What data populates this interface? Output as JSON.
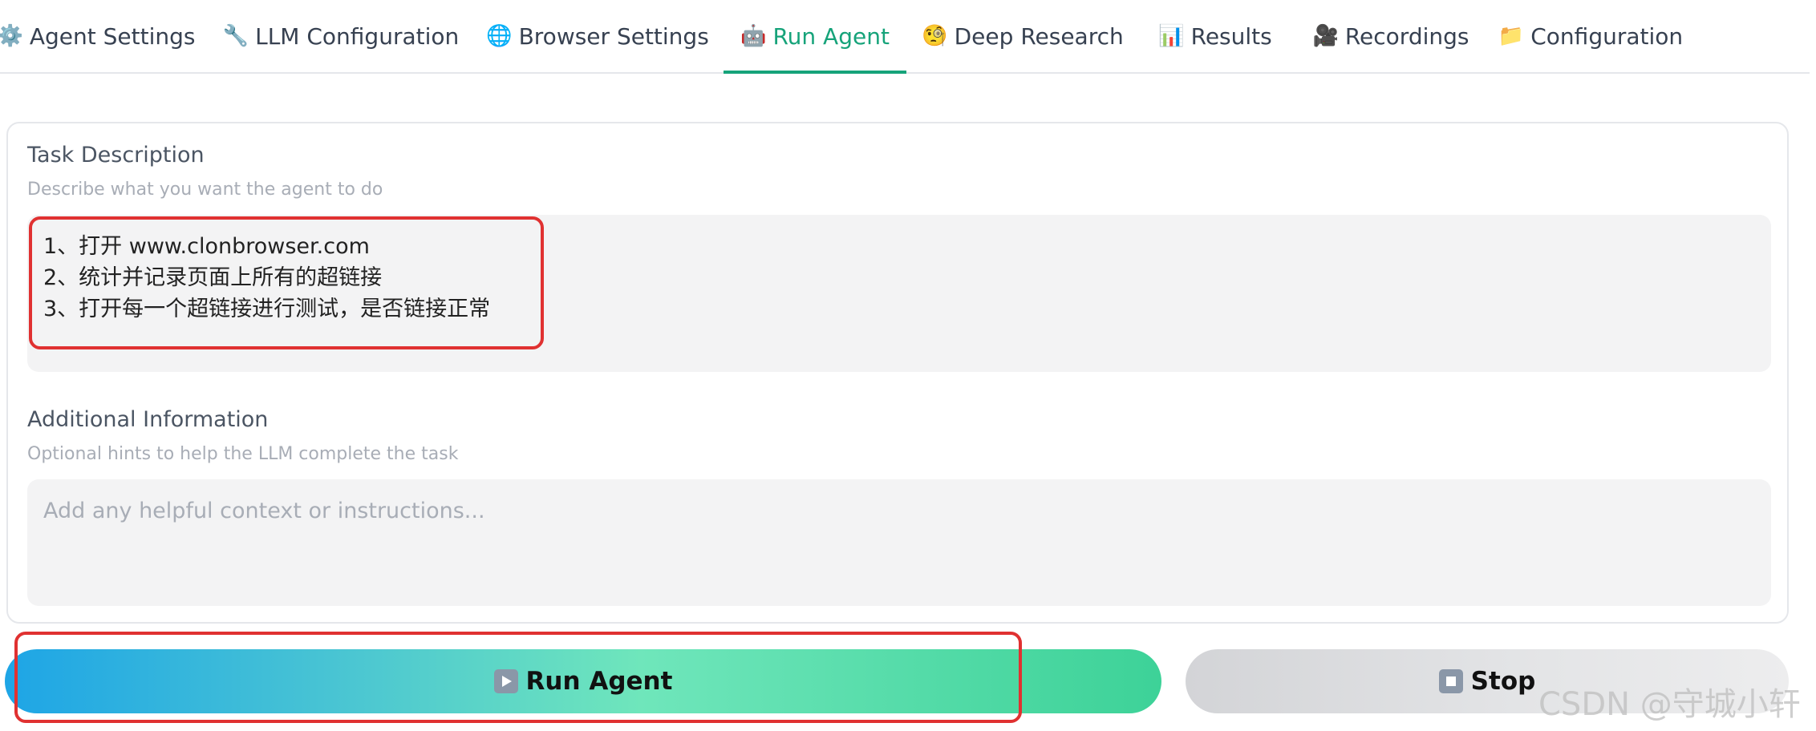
{
  "tabs": [
    {
      "icon": "⚙️",
      "icon_name": "gear-icon",
      "label": "Agent Settings"
    },
    {
      "icon": "🔧",
      "icon_name": "wrench-icon",
      "label": "LLM Configuration"
    },
    {
      "icon": "🌐",
      "icon_name": "globe-icon",
      "label": "Browser Settings"
    },
    {
      "icon": "🤖",
      "icon_name": "robot-icon",
      "label": "Run Agent",
      "active": true
    },
    {
      "icon": "🧐",
      "icon_name": "monocle-face-icon",
      "label": "Deep Research"
    },
    {
      "icon": "📊",
      "icon_name": "bar-chart-icon",
      "label": "Results"
    },
    {
      "icon": "🎥",
      "icon_name": "movie-camera-icon",
      "label": "Recordings"
    },
    {
      "icon": "📁",
      "icon_name": "folder-icon",
      "label": "Configuration"
    }
  ],
  "task": {
    "label": "Task Description",
    "hint": "Describe what you want the agent to do",
    "value": "1、打开 www.clonbrowser.com\n2、统计并记录页面上所有的超链接\n3、打开每一个超链接进行测试，是否链接正常"
  },
  "additional": {
    "label": "Additional Information",
    "hint": "Optional hints to help the LLM complete the task",
    "placeholder": "Add any helpful context or instructions..."
  },
  "buttons": {
    "run_label": "Run Agent",
    "stop_label": "Stop"
  },
  "watermark": "CSDN @守城小轩",
  "colors": {
    "accent": "#16a37a",
    "annotation": "#e03131",
    "run_gradient_start": "#1ea5e6",
    "run_gradient_end": "#3dd298",
    "stop_gradient": "#d3d4d7"
  }
}
